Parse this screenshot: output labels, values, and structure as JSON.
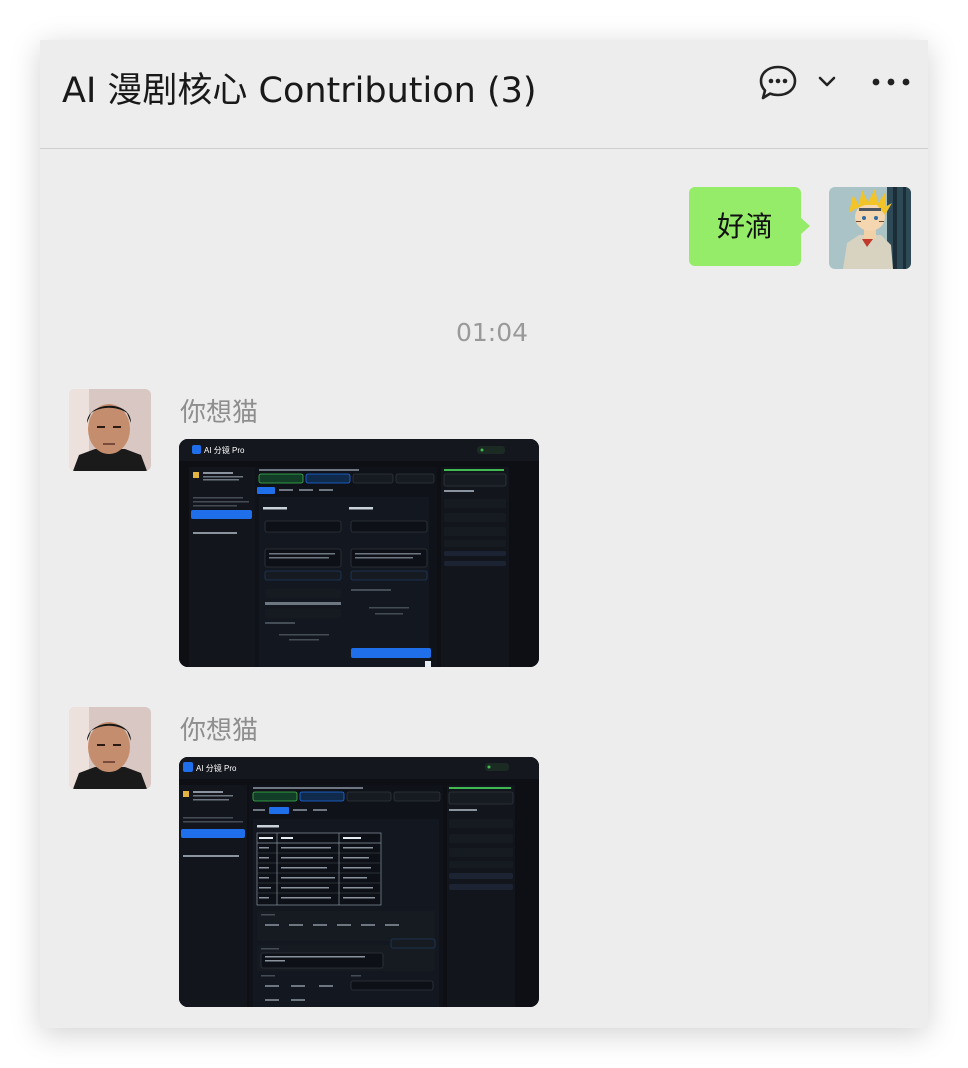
{
  "header": {
    "title": "AI 漫剧核心 Contribution (3)",
    "icons": [
      "chat-bubble-icon",
      "chevron-down-icon",
      "more-icon"
    ]
  },
  "messages": [
    {
      "type": "text",
      "from": "me",
      "text": "好滴",
      "bubble_color": "#95ec69"
    },
    {
      "type": "time",
      "text": "01:04"
    },
    {
      "type": "image",
      "from": "other",
      "sender": "你想猫",
      "image": {
        "app_name": "AI 分镜 Pro"
      }
    },
    {
      "type": "image",
      "from": "other",
      "sender": "你想猫",
      "image": {
        "app_name": "AI 分镜 Pro"
      }
    }
  ],
  "colors": {
    "background": "#ededed",
    "accent_blue": "#1f6feb",
    "accent_green": "#3fb950"
  }
}
